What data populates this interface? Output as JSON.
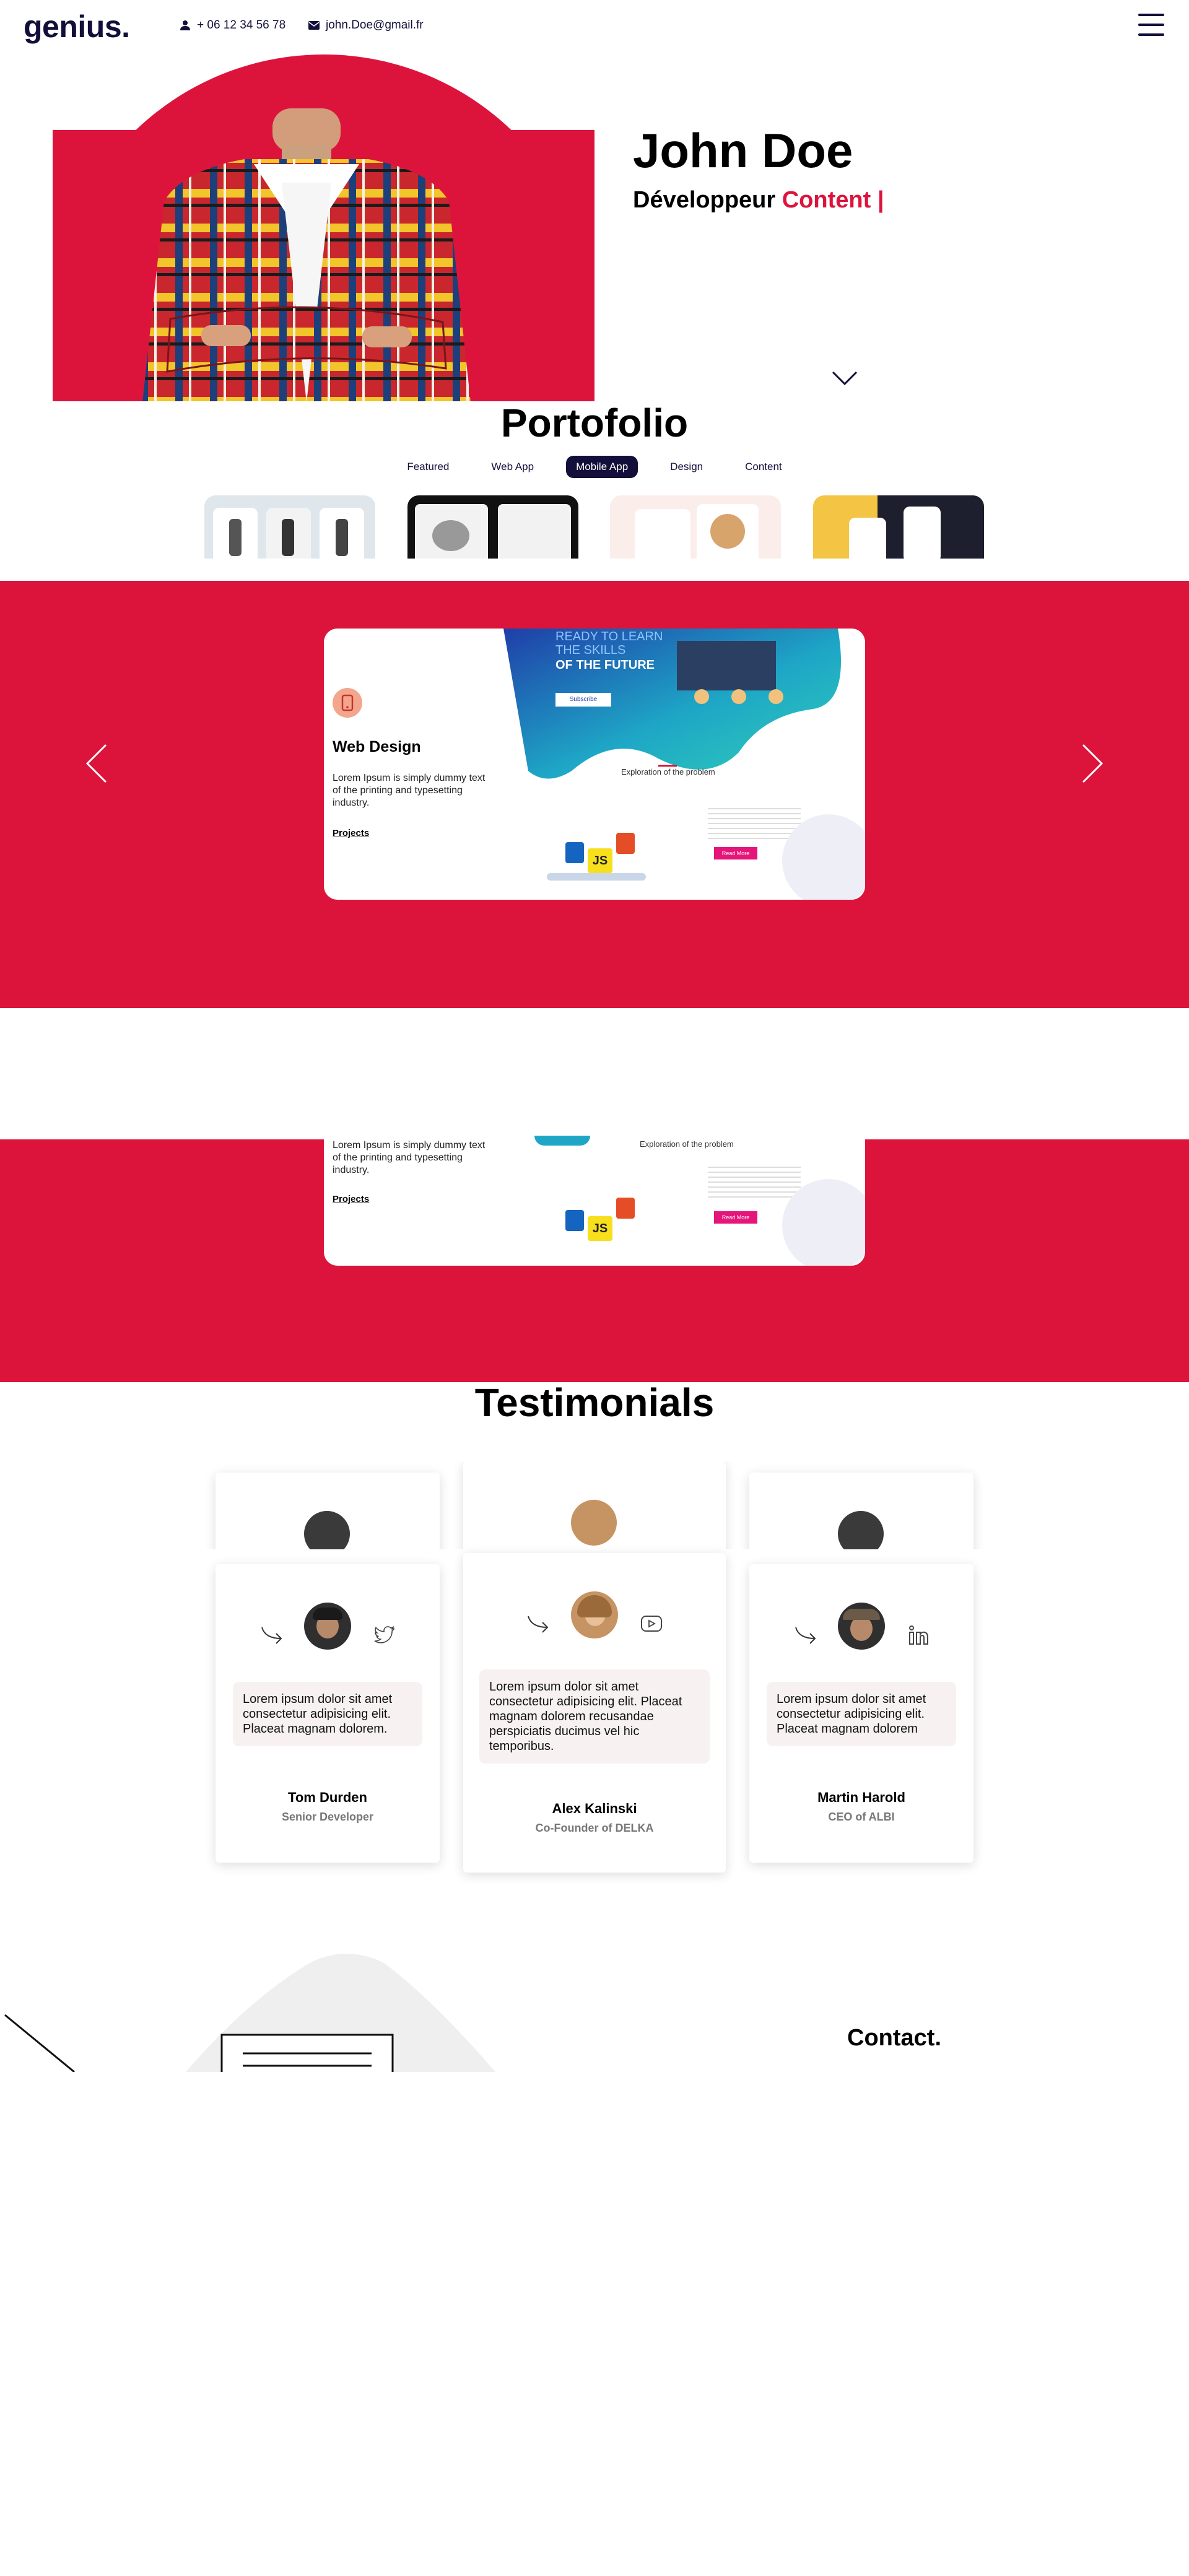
{
  "header": {
    "logo": "genius.",
    "phone": "+ 06 12 34 56 78",
    "email": "john.Doe@gmail.fr"
  },
  "hero": {
    "name": "John Doe",
    "role_prefix": "Développeur",
    "role_accent": "Content |"
  },
  "portfolio": {
    "title": "Portofolio",
    "filters": [
      "Featured",
      "Web App",
      "Mobile App",
      "Design",
      "Content"
    ],
    "active_filter": "Mobile App"
  },
  "slider": {
    "title": "Web Design",
    "description": "Lorem Ipsum is simply dummy text of the printing and typesetting industry.",
    "link": "Projects",
    "mock_heading_1": "READY TO LEARN",
    "mock_heading_2": "THE SKILLS",
    "mock_heading_3": "OF THE FUTURE",
    "mock_button": "Subscribe",
    "mock_subtitle": "Exploration of the problem",
    "mock_cta": "Read More"
  },
  "testimonials": {
    "title": "Testimonials",
    "items": [
      {
        "quote": "Lorem ipsum dolor sit amet consectetur adipisicing elit. Placeat magnam dolorem.",
        "name": "Tom Durden",
        "role": "Senior Developer",
        "social": "twitter-icon"
      },
      {
        "quote": "Lorem ipsum dolor sit amet consectetur adipisicing elit. Placeat magnam dolorem recusandae perspiciatis ducimus vel hic temporibus.",
        "name": "Alex Kalinski",
        "role": "Co-Founder of DELKA",
        "social": "youtube-icon"
      },
      {
        "quote": "Lorem ipsum dolor sit amet consectetur adipisicing elit. Placeat magnam dolorem",
        "name": "Martin Harold",
        "role": "CEO of ALBI",
        "social": "linkedin-icon"
      }
    ]
  },
  "contact": {
    "title": "Contact."
  },
  "colors": {
    "accent": "#dc143c",
    "navy": "#12103a"
  }
}
